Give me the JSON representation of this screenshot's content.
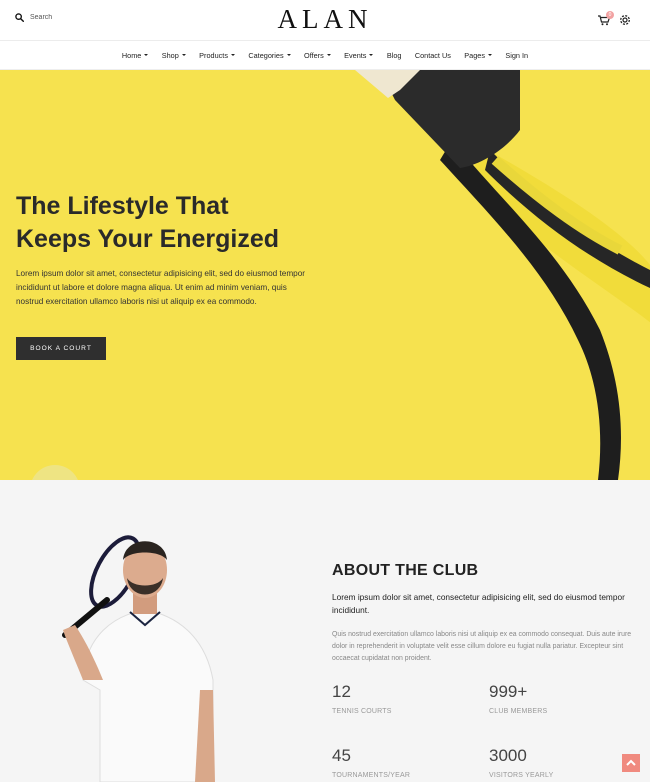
{
  "header": {
    "search_placeholder": "Search",
    "logo": "ALAN",
    "cart_count": "0"
  },
  "nav": {
    "items": [
      {
        "label": "Home",
        "dropdown": true
      },
      {
        "label": "Shop",
        "dropdown": true
      },
      {
        "label": "Products",
        "dropdown": true
      },
      {
        "label": "Categories",
        "dropdown": true
      },
      {
        "label": "Offers",
        "dropdown": true
      },
      {
        "label": "Events",
        "dropdown": true
      },
      {
        "label": "Blog",
        "dropdown": false
      },
      {
        "label": "Contact Us",
        "dropdown": false
      },
      {
        "label": "Pages",
        "dropdown": true
      },
      {
        "label": "Sign In",
        "dropdown": false
      }
    ]
  },
  "hero": {
    "title_line1": "The Lifestyle That",
    "title_line2": "Keeps Your Energized",
    "text": "Lorem ipsum dolor sit amet, consectetur adipisicing elit, sed do eiusmod tempor incididunt ut labore et dolore magna aliqua. Ut enim ad minim veniam, quis nostrud exercitation ullamco laboris nisi ut aliquip ex ea commodo.",
    "button": "BOOK A COURT"
  },
  "about": {
    "title": "ABOUT THE CLUB",
    "lead": "Lorem ipsum dolor sit amet, consectetur adipisicing elit, sed do eiusmod tempor incididunt.",
    "text": "Quis nostrud exercitation ullamco laboris nisi ut aliquip ex ea commodo consequat. Duis aute irure dolor in reprehenderit in voluptate velit esse cillum dolore eu fugiat nulla pariatur. Excepteur sint occaecat cupidatat non proident.",
    "stats": [
      {
        "value": "12",
        "label": "TENNIS COURTS"
      },
      {
        "value": "999+",
        "label": "CLUB MEMBERS"
      },
      {
        "value": "45",
        "label": "TOURNAMENTS/YEAR"
      },
      {
        "value": "3000",
        "label": "VISITORS YEARLY"
      }
    ]
  },
  "colors": {
    "hero_yellow": "#f6e24f",
    "button_dark": "#2f2f2f",
    "accent_coral": "#f08a7f",
    "badge_pink": "#f2a2a2"
  }
}
